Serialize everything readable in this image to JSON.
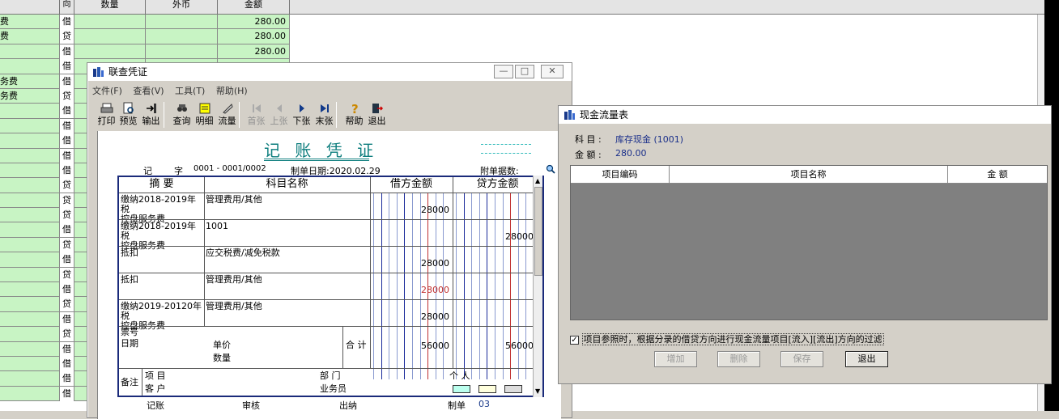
{
  "background": {
    "headers": [
      "向",
      "数量",
      "外币",
      "金额"
    ],
    "rows": [
      {
        "name": "费",
        "dir": "借",
        "amount": "280.00"
      },
      {
        "name": "费",
        "dir": "贷",
        "amount": "280.00"
      },
      {
        "name": "",
        "dir": "借",
        "amount": "280.00"
      },
      {
        "name": "",
        "dir": "借",
        "amount": ""
      },
      {
        "name": "务费",
        "dir": "借",
        "amount": ""
      },
      {
        "name": "务费",
        "dir": "贷",
        "amount": ""
      },
      {
        "name": "",
        "dir": "借",
        "amount": ""
      },
      {
        "name": "",
        "dir": "借",
        "amount": ""
      },
      {
        "name": "",
        "dir": "借",
        "amount": ""
      },
      {
        "name": "",
        "dir": "借",
        "amount": ""
      },
      {
        "name": "",
        "dir": "借",
        "amount": ""
      },
      {
        "name": "",
        "dir": "贷",
        "amount": ""
      },
      {
        "name": "",
        "dir": "贷",
        "amount": ""
      },
      {
        "name": "",
        "dir": "贷",
        "amount": ""
      },
      {
        "name": "",
        "dir": "借",
        "amount": ""
      },
      {
        "name": "",
        "dir": "贷",
        "amount": ""
      },
      {
        "name": "",
        "dir": "借",
        "amount": ""
      },
      {
        "name": "",
        "dir": "贷",
        "amount": ""
      },
      {
        "name": "",
        "dir": "借",
        "amount": ""
      },
      {
        "name": "",
        "dir": "贷",
        "amount": ""
      },
      {
        "name": "",
        "dir": "借",
        "amount": ""
      },
      {
        "name": "",
        "dir": "贷",
        "amount": ""
      },
      {
        "name": "",
        "dir": "借",
        "amount": ""
      },
      {
        "name": "",
        "dir": "借",
        "amount": ""
      },
      {
        "name": "",
        "dir": "借",
        "amount": ""
      },
      {
        "name": "",
        "dir": "借",
        "amount": ""
      }
    ]
  },
  "voucher_window": {
    "title": "联查凭证",
    "menu": [
      "文件(F)",
      "查看(V)",
      "工具(T)",
      "帮助(H)"
    ],
    "toolbar": [
      "打印",
      "预览",
      "输出",
      "查询",
      "明细",
      "流量",
      "首张",
      "上张",
      "下张",
      "末张",
      "帮助",
      "退出"
    ],
    "voucher_title": "记 账 凭 证",
    "type_label": "记",
    "zi_label": "字",
    "number": "0001 - 0001/0002",
    "date_text": "制单日期:2020.02.29",
    "attach_label": "附单据数:",
    "col_summary": "摘 要",
    "col_account": "科目名称",
    "col_debit": "借方金额",
    "col_credit": "贷方金额",
    "entries": [
      {
        "summary": "缴纳2018-2019年税\n控盘服务费",
        "account": "管理费用/其他",
        "debit": "28000",
        "credit": ""
      },
      {
        "summary": "缴纳2018-2019年税\n控盘服务费",
        "account": "1001",
        "debit": "",
        "credit": "28000"
      },
      {
        "summary": "抵扣",
        "account": "应交税费/减免税款",
        "debit": "28000",
        "credit": ""
      },
      {
        "summary": "抵扣",
        "account": "管理费用/其他",
        "debit": "28000",
        "credit": ""
      },
      {
        "summary": "缴纳2019-20120年税\n控盘服务费",
        "account": "管理费用/其他",
        "debit": "28000",
        "credit": ""
      }
    ],
    "ticket_no_label": "票号",
    "date_label": "日期",
    "unit_price_label": "单价",
    "quantity_label": "数量",
    "total_label": "合 计",
    "total_debit": "56000",
    "total_credit": "56000",
    "remark_label": "备注",
    "project_label": "项 目",
    "dept_label": "部 门",
    "person_label": "个 人",
    "customer_label": "客 户",
    "salesman_label": "业务员",
    "bookkeep_label": "记账",
    "audit_label": "审核",
    "cashier_label": "出纳",
    "maker_label": "制单",
    "maker_value": "03"
  },
  "cashflow_window": {
    "title": "现金流量表",
    "subject_label": "科 目 :",
    "subject_value": "库存现金 (1001)",
    "amount_label": "金 额 :",
    "amount_value": "280.00",
    "columns": [
      "项目编码",
      "项目名称",
      "金 额"
    ],
    "check_label": "项目参照时，根据分录的借贷方向进行现金流量项目[流入][流出]方向的过滤",
    "buttons": [
      "增加",
      "删除",
      "保存",
      "退出"
    ]
  }
}
